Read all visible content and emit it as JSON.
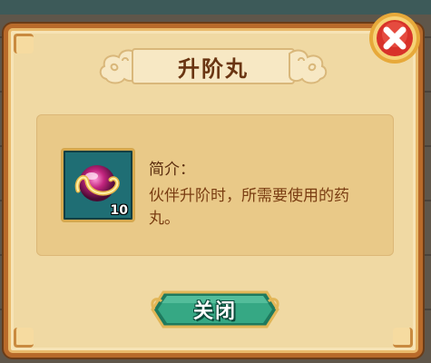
{
  "dialog": {
    "title": "升阶丸",
    "description_label": "简介：",
    "description_text": "伙伴升阶时，所需要使用的药丸。",
    "close_button_label": "关闭"
  },
  "item": {
    "name": "升阶丸",
    "count": "10",
    "icon": "pill-orb-icon"
  },
  "colors": {
    "frame": "#b86a2a",
    "panel": "#e9c988",
    "title_text": "#6a3512",
    "slot_bg": "#1f6e74",
    "button_green": "#2f9a7a",
    "close_red": "#d8322a"
  }
}
